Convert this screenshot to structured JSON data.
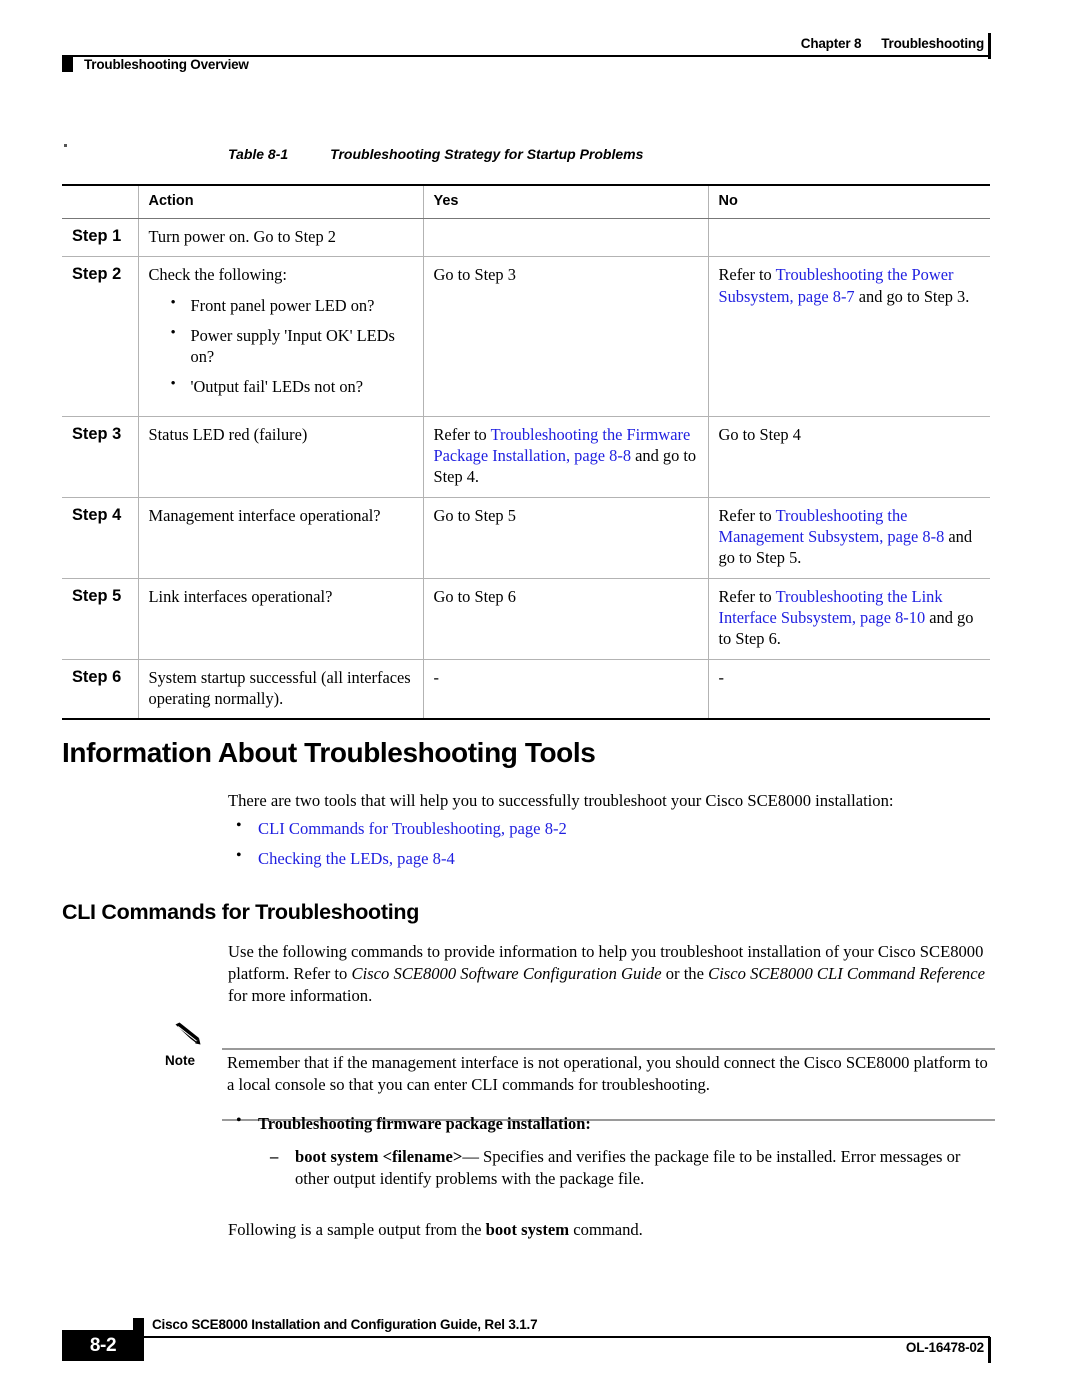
{
  "header": {
    "chapter_number": "Chapter 8",
    "chapter_title": "Troubleshooting",
    "section_label": "Troubleshooting Overview"
  },
  "table": {
    "caption_number": "Table 8-1",
    "caption_title": "Troubleshooting Strategy for Startup Problems",
    "columns": [
      "",
      "Action",
      "Yes",
      "No"
    ],
    "rows": [
      {
        "step": "Step 1",
        "action": "Turn power on. Go to Step 2",
        "yes": "",
        "no": ""
      },
      {
        "step": "Step 2",
        "action": "Check the following:",
        "action_bullets": [
          "Front panel power LED on?",
          "Power supply 'Input OK' LEDs on?",
          "'Output fail' LEDs not on?"
        ],
        "yes": "Go to Step 3",
        "no_prefix": "Refer to ",
        "no_link": "Troubleshooting the Power Subsystem, page 8-7",
        "no_suffix": " and go to Step 3."
      },
      {
        "step": "Step 3",
        "action": "Status LED red (failure)",
        "yes_prefix": "Refer to ",
        "yes_link": "Troubleshooting the Firmware Package Installation, page 8-8",
        "yes_suffix": " and go to Step 4.",
        "no": "Go to Step 4"
      },
      {
        "step": "Step 4",
        "action": "Management interface operational?",
        "yes": "Go to Step 5",
        "no_prefix": "Refer to ",
        "no_link": "Troubleshooting the Management Subsystem, page 8-8",
        "no_suffix": " and go to Step 5."
      },
      {
        "step": "Step 5",
        "action": "Link interfaces operational?",
        "yes": "Go to Step 6",
        "no_prefix": "Refer to ",
        "no_link": "Troubleshooting the Link Interface Subsystem, page 8-10",
        "no_suffix": " and go to Step 6."
      },
      {
        "step": "Step 6",
        "action": "System startup successful (all interfaces operating normally).",
        "yes": "-",
        "no": "-"
      }
    ]
  },
  "sections": {
    "h1_title": "Information About Troubleshooting Tools",
    "intro_paragraph": "There are two tools that will help you to successfully troubleshoot your Cisco SCE8000 installation:",
    "tool_links": [
      "CLI Commands for Troubleshooting, page 8-2",
      "Checking the LEDs, page 8-4"
    ],
    "h2_title": "CLI Commands for Troubleshooting",
    "cli_paragraph": {
      "part1": "Use the following commands to provide information to help you troubleshoot installation of your Cisco SCE8000 platform. Refer to ",
      "italic1": "Cisco SCE8000 Software Configuration Guide",
      "part2": " or the ",
      "italic2": "Cisco SCE8000 CLI Command Reference",
      "part3": " for more information."
    }
  },
  "note": {
    "label": "Note",
    "icon": "pencil-icon",
    "text": "Remember that if the management interface is not operational, you should connect the Cisco SCE8000 platform to a local console so that you can enter CLI commands for troubleshooting."
  },
  "command_list": {
    "heading_bullet": "Troubleshooting firmware package installation:",
    "dash_item": {
      "command": "boot system <filename>",
      "description": "— Specifies and verifies the package file to be installed. Error messages or other output identify problems with the package file."
    },
    "following_text": {
      "part1": "Following is a sample output from the ",
      "bold": "boot system",
      "part2": " command."
    }
  },
  "footer": {
    "guide_title": "Cisco SCE8000 Installation and Configuration Guide, Rel 3.1.7",
    "page_number": "8-2",
    "doc_id": "OL-16478-02"
  },
  "colors": {
    "link_blue": "#1f1fe0",
    "rule_black": "#000000",
    "table_grid": "#b3b3b3"
  }
}
